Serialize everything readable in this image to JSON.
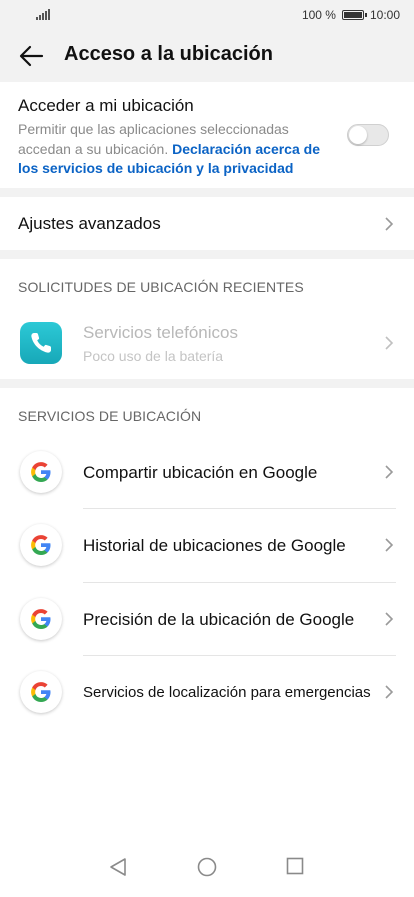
{
  "status_bar": {
    "battery_percent": "100 %",
    "time": "10:00"
  },
  "header": {
    "title": "Acceso a la ubicación",
    "back_icon": "arrow-left-icon"
  },
  "location_access": {
    "title": "Acceder a mi ubicación",
    "description": "Permitir que las aplicaciones seleccionadas accedan a su ubicación.",
    "link": "Declaración acerca de los servicios de ubicación y la privacidad",
    "toggle_on": false
  },
  "advanced": {
    "label": "Ajustes avanzados"
  },
  "recent_requests": {
    "header": "SOLICITUDES DE UBICACIÓN RECIENTES",
    "items": [
      {
        "title": "Servicios telefónicos",
        "subtitle": "Poco uso de la batería",
        "icon": "phone-icon"
      }
    ]
  },
  "location_services": {
    "header": "SERVICIOS DE UBICACIÓN",
    "items": [
      {
        "label": "Compartir ubicación en Google",
        "icon": "google-icon"
      },
      {
        "label": "Historial de ubicaciones de Google",
        "icon": "google-icon"
      },
      {
        "label": "Precisión de la ubicación de Google",
        "icon": "google-icon"
      },
      {
        "label": "Servicios de localización para emergencias",
        "icon": "google-icon"
      }
    ]
  },
  "colors": {
    "background": "#ffffff",
    "section_gap": "#f2f2f2",
    "link": "#0b63c5",
    "phone_app": "#1fb5c4"
  }
}
